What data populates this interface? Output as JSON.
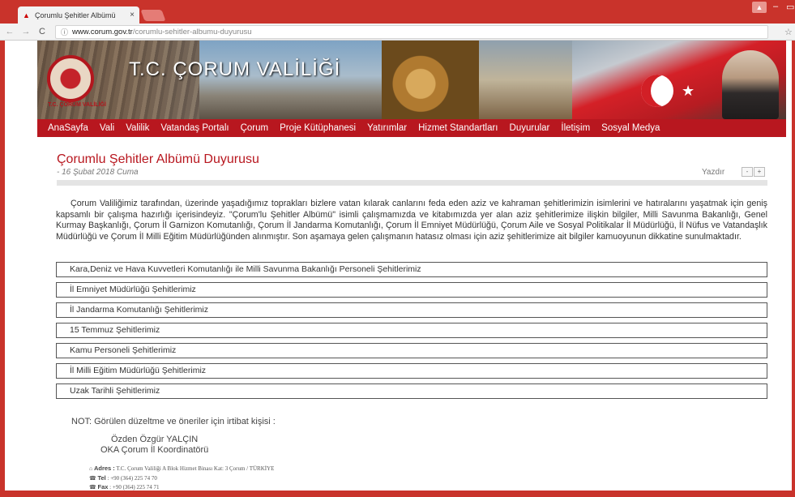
{
  "browser": {
    "tab_title": "Çorumlu Şehitler Albümü",
    "tab_close": "×",
    "url_domain": "www.corum.gov.tr",
    "url_path": "/corumlu-sehitler-albumu-duyurusu"
  },
  "icons": {
    "back": "←",
    "forward": "→",
    "reload": "C",
    "info": "ⓘ",
    "star": "☆",
    "minimize": "–",
    "maximize": "▭",
    "user": "▲"
  },
  "header": {
    "title": "T.C. ÇORUM VALİLİĞİ",
    "emblem_text": "T.C. ÇORUM VALİLİĞİ",
    "accent": "#b8171f"
  },
  "menu": [
    "AnaSayfa",
    "Vali",
    "Valilik",
    "Vatandaş Portalı",
    "Çorum",
    "Proje Kütüphanesi",
    "Yatırımlar",
    "Hizmet Standartları",
    "Duyurular",
    "İletişim",
    "Sosyal Medya"
  ],
  "article": {
    "title": "Çorumlu Şehitler Albümü Duyurusu",
    "date": "- 16 Şubat 2018 Cuma",
    "print": "Yazdır",
    "font_minus": "-",
    "font_plus": "+",
    "intro": "Çorum Valiliğimiz tarafından, üzerinde yaşadığımız toprakları bizlere vatan kılarak canlarını feda eden aziz ve kahraman şehitlerimizin isimlerini ve hatıralarını yaşatmak için geniş kapsamlı bir çalışma hazırlığı içerisindeyiz. \"Çorum'lu Şehitler Albümü\" isimli çalışmamızda ve kitabımızda yer alan aziz şehitlerimize ilişkin bilgiler, Milli Savunma Bakanlığı, Genel Kurmay Başkanlığı, Çorum İl Garnizon Komutanlığı, Çorum İl Jandarma Komutanlığı, Çorum İl Emniyet Müdürlüğü, Çorum Aile ve Sosyal Politikalar İl Müdürlüğü, İl Nüfus ve Vatandaşlık Müdürlüğü ve Çorum İl Milli Eğitim Müdürlüğünden alınmıştır. Son aşamaya gelen çalışmanın hatasız olması için aziz şehitlerimize ait bilgiler kamuoyunun dikkatine sunulmaktadır.",
    "sections": [
      "Kara,Deniz ve Hava Kuvvetleri Komutanlığı ile Milli Savunma Bakanlığı Personeli Şehitlerimiz",
      "İl Emniyet Müdürlüğü Şehitlerimiz",
      "İl Jandarma Komutanlığı Şehitlerimiz",
      "15 Temmuz Şehitlerimiz",
      "Kamu Personeli Şehitlerimiz",
      "İl Milli Eğitim Müdürlüğü Şehitlerimiz",
      "Uzak Tarihli Şehitlerimiz"
    ],
    "note": "NOT: Görülen düzeltme ve öneriler için irtibat kişisi :",
    "contact_name": "Özden Özgür YALÇIN",
    "contact_role": "OKA Çorum İl Koordinatörü"
  },
  "footer": {
    "address_label": "Adres :",
    "address": "T.C. Çorum Valiliği A Blok Hizmet Binası Kat: 3 Çorum / TÜRKİYE",
    "tel_label": "Tel",
    "tel": ": +90 (364) 225 74 70",
    "fax_label": "Fax",
    "fax": ": +90 (364) 225 74 71"
  }
}
